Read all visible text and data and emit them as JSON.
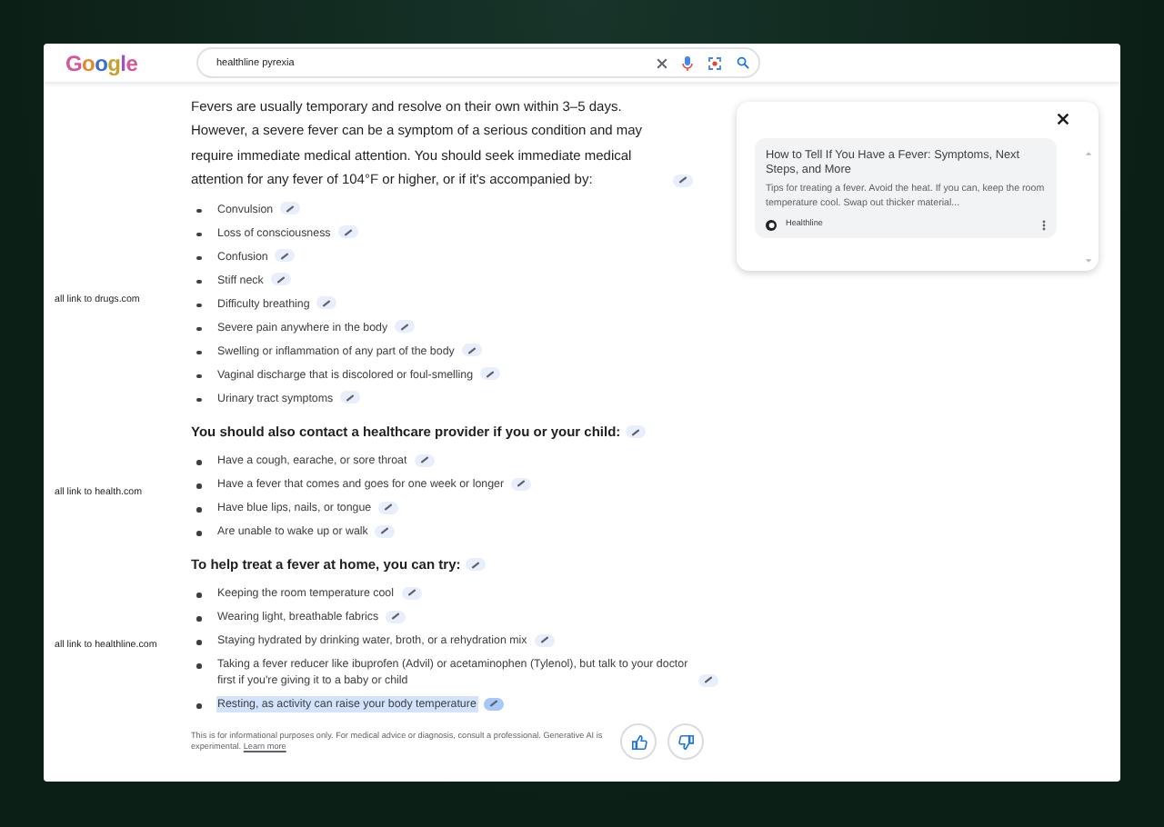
{
  "header": {
    "logo": "Google",
    "query": "healthline pyrexia"
  },
  "sections": [
    {
      "kind": "paragraph",
      "heading": "Fevers are usually temporary and resolve on their own within 3–5 days. However, a severe fever can be a symptom of a serious condition and may require immediate medical attention. You should seek immediate medical attention for any fever of 104°F or higher, or if it's accompanied by:",
      "note": "all link to drugs.com",
      "items": [
        {
          "text": "Convulsion",
          "highlighted": false
        },
        {
          "text": "Loss of consciousness",
          "highlighted": false
        },
        {
          "text": "Confusion",
          "highlighted": false
        },
        {
          "text": "Stiff neck",
          "highlighted": false
        },
        {
          "text": "Difficulty breathing",
          "highlighted": false
        },
        {
          "text": "Severe pain anywhere in the body",
          "highlighted": false
        },
        {
          "text": "Swelling or inflammation of any part of the body",
          "highlighted": false
        },
        {
          "text": "Vaginal discharge that is discolored or foul-smelling",
          "highlighted": false
        },
        {
          "text": "Urinary tract symptoms",
          "highlighted": false
        }
      ]
    },
    {
      "kind": "heading",
      "heading": "You should also contact a healthcare provider if you or your child:",
      "note": "all link to health.com",
      "items": [
        {
          "text": "Have a cough, earache, or sore throat",
          "highlighted": false
        },
        {
          "text": "Have a fever that comes and goes for one week or longer",
          "highlighted": false
        },
        {
          "text": "Have blue lips, nails, or tongue",
          "highlighted": false
        },
        {
          "text": "Are unable to wake up or walk",
          "highlighted": false
        }
      ]
    },
    {
      "kind": "heading",
      "heading": "To help treat a fever at home, you can try:",
      "note": "all link to healthline.com",
      "items": [
        {
          "text": "Keeping the room temperature cool",
          "highlighted": false
        },
        {
          "text": "Wearing light, breathable fabrics",
          "highlighted": false
        },
        {
          "text": "Staying hydrated by drinking water, broth, or a rehydration mix",
          "highlighted": false
        },
        {
          "text": "Taking a fever reducer like ibuprofen (Advil) or acetaminophen (Tylenol), but talk to your doctor first if you're giving it to a baby or child",
          "highlighted": false
        },
        {
          "text": "Resting, as activity can raise your body temperature",
          "highlighted": true
        }
      ]
    }
  ],
  "disclaimer": {
    "text": "This is for informational purposes only. For medical advice or diagnosis, consult a professional. Generative AI is experimental.",
    "link": "Learn more"
  },
  "source_card": {
    "title": "How to Tell If You Have a Fever: Symptoms, Next Steps, and More",
    "snippet": "Tips for treating a fever. Avoid the heat. If you can, keep the room temperature cool. Swap out thicker material...",
    "source": "Healthline"
  }
}
